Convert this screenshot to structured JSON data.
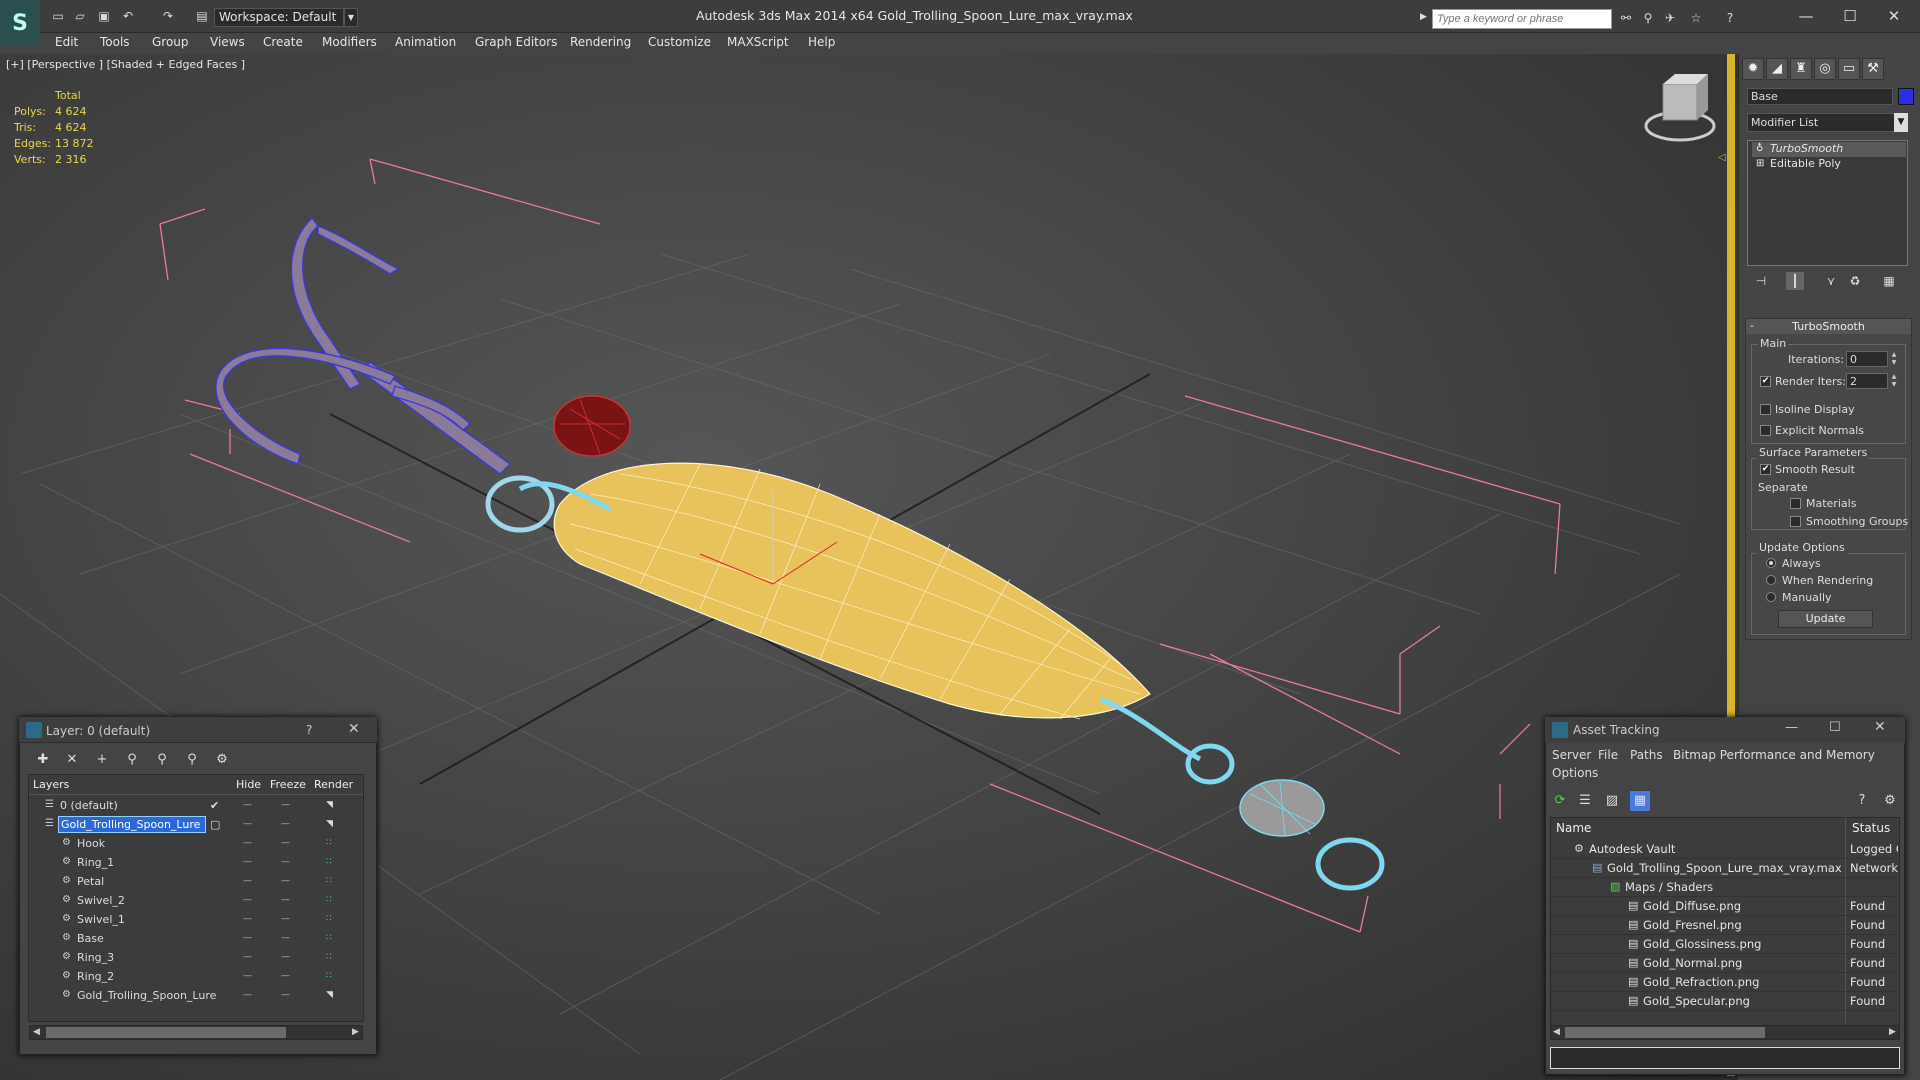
{
  "app": {
    "title": "Autodesk 3ds Max  2014 x64      Gold_Trolling_Spoon_Lure_max_vray.max",
    "workspace": "Workspace: Default",
    "search_placeholder": "Type a keyword or phrase"
  },
  "menu": [
    "Edit",
    "Tools",
    "Group",
    "Views",
    "Create",
    "Modifiers",
    "Animation",
    "Graph Editors",
    "Rendering",
    "Customize",
    "MAXScript",
    "Help"
  ],
  "viewport": {
    "label": "[+] [Perspective ] [Shaded + Edged Faces ]",
    "stats": {
      "header": "Total",
      "polys_label": "Polys:",
      "polys": "4 624",
      "tris_label": "Tris:",
      "tris": "4 624",
      "edges_label": "Edges:",
      "edges": "13 872",
      "verts_label": "Verts:",
      "verts": "2 316"
    }
  },
  "command_panel": {
    "object_name": "Base",
    "object_color": "#2e2ee6",
    "modifier_list": "Modifier List",
    "stack": [
      "TurboSmooth",
      "Editable Poly"
    ],
    "turbosmooth": {
      "header": "TurboSmooth",
      "main": "Main",
      "iterations_label": "Iterations:",
      "iterations": "0",
      "render_iters_label": "Render Iters:",
      "render_iters": "2",
      "isoline": "Isoline Display",
      "explicit_normals": "Explicit Normals",
      "surface_params": "Surface Parameters",
      "smooth_result": "Smooth Result",
      "separate": "Separate",
      "materials": "Materials",
      "smoothing_groups": "Smoothing Groups",
      "update_options": "Update Options",
      "always": "Always",
      "when_rendering": "When Rendering",
      "manually": "Manually",
      "update_button": "Update"
    }
  },
  "layer_dialog": {
    "title": "Layer: 0 (default)",
    "help": "?",
    "columns": [
      "Layers",
      "Hide",
      "Freeze",
      "Render"
    ],
    "rows": [
      {
        "name": "0 (default)",
        "indent": 0
      },
      {
        "name": "Gold_Trolling_Spoon_Lure",
        "indent": 0
      },
      {
        "name": "Hook",
        "indent": 1
      },
      {
        "name": "Ring_1",
        "indent": 1
      },
      {
        "name": "Petal",
        "indent": 1
      },
      {
        "name": "Swivel_2",
        "indent": 1
      },
      {
        "name": "Swivel_1",
        "indent": 1
      },
      {
        "name": "Base",
        "indent": 1
      },
      {
        "name": "Ring_3",
        "indent": 1
      },
      {
        "name": "Ring_2",
        "indent": 1
      },
      {
        "name": "Gold_Trolling_Spoon_Lure",
        "indent": 1
      }
    ]
  },
  "asset_dialog": {
    "title": "Asset Tracking",
    "menu": [
      "Server",
      "File",
      "Paths",
      "Bitmap Performance and Memory",
      "Options"
    ],
    "columns": [
      "Name",
      "Status"
    ],
    "rows": [
      {
        "name": "Autodesk Vault",
        "status": "Logged C",
        "indent": 1
      },
      {
        "name": "Gold_Trolling_Spoon_Lure_max_vray.max",
        "status": "Network I",
        "indent": 2
      },
      {
        "name": "Maps / Shaders",
        "status": "",
        "indent": 3
      },
      {
        "name": "Gold_Diffuse.png",
        "status": "Found",
        "indent": 4
      },
      {
        "name": "Gold_Fresnel.png",
        "status": "Found",
        "indent": 4
      },
      {
        "name": "Gold_Glossiness.png",
        "status": "Found",
        "indent": 4
      },
      {
        "name": "Gold_Normal.png",
        "status": "Found",
        "indent": 4
      },
      {
        "name": "Gold_Refraction.png",
        "status": "Found",
        "indent": 4
      },
      {
        "name": "Gold_Specular.png",
        "status": "Found",
        "indent": 4
      }
    ]
  }
}
